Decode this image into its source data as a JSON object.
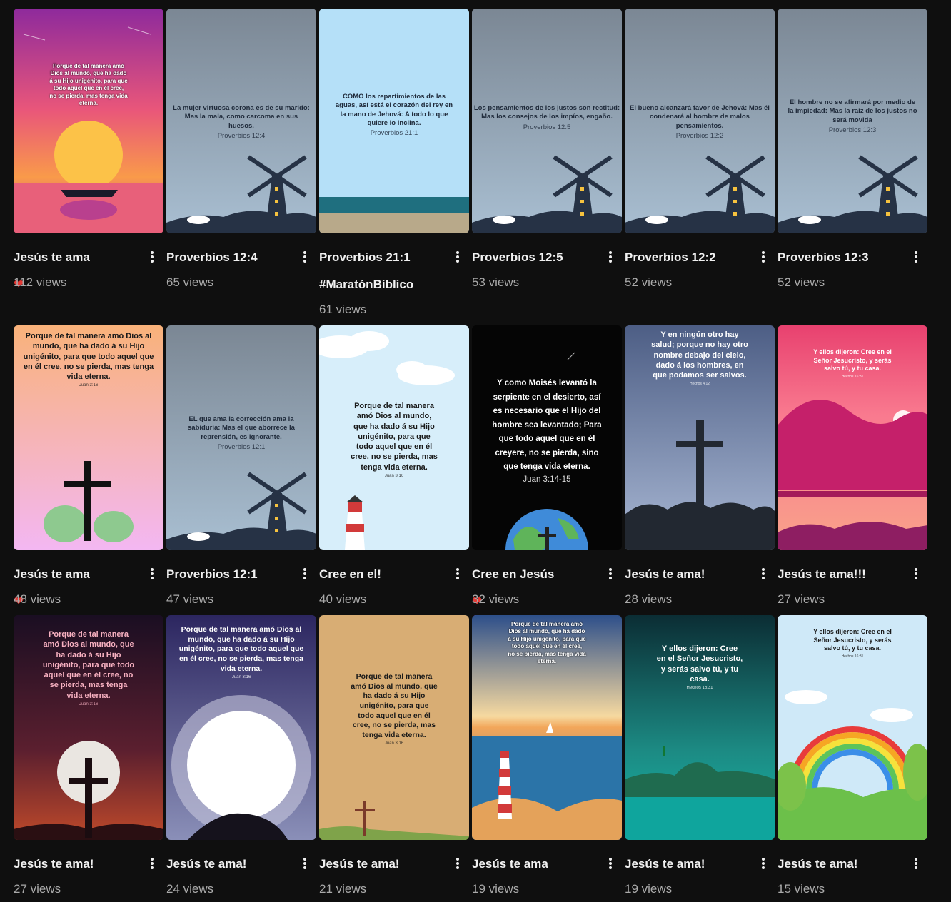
{
  "videos": [
    {
      "title": "Jesús te ama",
      "emoji": "heart",
      "views": "112 views",
      "caption": "Porque de tal manera amó Dios al mundo, que ha dado á su Hijo unigénito, para que todo aquel que en él cree, no se pierda, mas tenga vida eterna.",
      "ref": ""
    },
    {
      "title": "Proverbios 12:4",
      "views": "65 views",
      "caption": "La mujer virtuosa corona es de su marido: Mas la mala, como carcoma en sus huesos.",
      "ref": "Proverbios 12:4"
    },
    {
      "title": "Proverbios 21:1",
      "title2": "#MaratónBíblico",
      "views": "61 views",
      "caption": "COMO los repartimientos de las aguas, así está el corazón del rey en la mano de Jehová: A todo lo que quiere lo inclina.",
      "ref": "Proverbios 21:1"
    },
    {
      "title": "Proverbios 12:5",
      "views": "53 views",
      "caption": "Los pensamientos de los justos son rectitud: Mas los consejos de los impíos, engaño.",
      "ref": "Proverbios 12:5"
    },
    {
      "title": "Proverbios 12:2",
      "views": "52 views",
      "caption": "El bueno alcanzará favor de Jehová: Mas él condenará al hombre de malos pensamientos.",
      "ref": "Proverbios 12:2"
    },
    {
      "title": "Proverbios 12:3",
      "views": "52 views",
      "caption": "El hombre no se afirmará por medio de la impiedad: Mas la raíz de los justos no será movida",
      "ref": "Proverbios 12:3"
    },
    {
      "title": "Jesús te ama",
      "emoji": "heart",
      "views": "48 views",
      "caption": "Porque de tal manera amó Dios al mundo, que ha dado á su Hijo unigénito, para que todo aquel que en él cree, no se pierda, mas tenga vida eterna.",
      "ref": "Juan 3:16"
    },
    {
      "title": "Proverbios 12:1",
      "views": "47 views",
      "caption": "EL que ama la corrección ama la sabiduría: Mas el que aborrece la reprensión, es ignorante.",
      "ref": "Proverbios 12:1"
    },
    {
      "title": "Cree en el!",
      "views": "40 views",
      "caption": "Porque de tal manera amó Dios al mundo, que ha dado á su Hijo unigénito, para que todo aquel que en él cree, no se pierda, mas tenga vida eterna.",
      "ref": "Juan 3:16"
    },
    {
      "title": "Cree en Jesús",
      "emoji": "heart-cross",
      "views": "32 views",
      "caption": "Y como Moisés levantó la serpiente en el desierto, así es necesario que el Hijo del hombre sea levantado; Para que todo aquel que en él creyere, no se pierda, sino que tenga vida eterna.",
      "ref": "Juan 3:14-15"
    },
    {
      "title": "Jesús te ama!",
      "views": "28 views",
      "caption": "Y en ningún otro hay salud; porque no hay otro nombre debajo del cielo, dado á los hombres, en que podamos ser salvos.",
      "ref": "Hechos 4:12"
    },
    {
      "title": "Jesús te ama!!!",
      "views": "27 views",
      "caption": "Y ellos dijeron: Cree en el Señor Jesucristo, y serás salvo tú, y tu casa.",
      "ref": "Hechos 16:31"
    },
    {
      "title": "Jesús te ama!",
      "views": "27 views",
      "caption": "Porque de tal manera amó Dios al mundo, que ha dado á su Hijo unigénito, para que todo aquel que en él cree, no se pierda, mas tenga vida eterna.",
      "ref": "Juan 3:16"
    },
    {
      "title": "Jesús te ama!",
      "views": "24 views",
      "caption": "Porque de tal manera amó Dios al mundo, que ha dado á su Hijo unigénito, para que todo aquel que en él cree, no se pierda, mas tenga vida eterna.",
      "ref": "Juan 3:16"
    },
    {
      "title": "Jesús te ama!",
      "views": "21 views",
      "caption": "Porque de tal manera amó Dios al mundo, que ha dado á su Hijo unigénito, para que todo aquel que en él cree, no se pierda, mas tenga vida eterna.",
      "ref": "Juan 3:16"
    },
    {
      "title": "Jesús te ama",
      "views": "19 views",
      "caption": "Porque de tal manera amó Dios al mundo, que ha dado á su Hijo unigénito, para que todo aquel que en él cree, no se pierda, mas tenga vida eterna.",
      "ref": ""
    },
    {
      "title": "Jesús te ama!",
      "views": "19 views",
      "caption": "Y ellos dijeron: Cree en el Señor Jesucristo, y serás salvo tú, y tu casa.",
      "ref": "Hechos 16:31"
    },
    {
      "title": "Jesús te ama!",
      "views": "15 views",
      "caption": "Y ellos dijeron: Cree en el Señor Jesucristo, y serás salvo tú, y tu casa.",
      "ref": "Hechos 16:31"
    }
  ]
}
